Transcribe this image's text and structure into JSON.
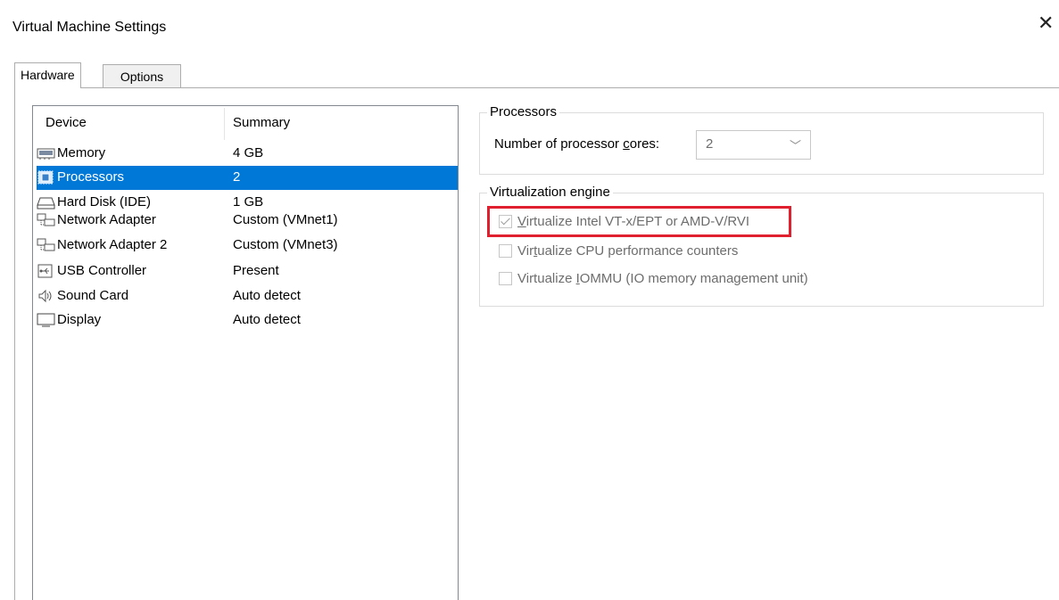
{
  "window": {
    "title": "Virtual Machine Settings",
    "close_icon": "close-icon"
  },
  "tabs": [
    {
      "label": "Hardware",
      "active": true
    },
    {
      "label": "Options",
      "active": false
    }
  ],
  "device_list": {
    "columns": {
      "device": "Device",
      "summary": "Summary"
    },
    "rows": [
      {
        "icon": "memory-icon",
        "device": "Memory",
        "summary": "4 GB",
        "selected": false
      },
      {
        "icon": "processor-icon",
        "device": "Processors",
        "summary": "2",
        "selected": true
      },
      {
        "icon": "hard-disk-icon",
        "device": "Hard Disk (IDE)",
        "summary": "1 GB",
        "selected": false
      },
      {
        "icon": "network-adapter-icon",
        "device": "Network Adapter",
        "summary": "Custom (VMnet1)",
        "selected": false
      },
      {
        "icon": "network-adapter-icon",
        "device": "Network Adapter 2",
        "summary": "Custom (VMnet3)",
        "selected": false
      },
      {
        "icon": "usb-icon",
        "device": "USB Controller",
        "summary": "Present",
        "selected": false
      },
      {
        "icon": "sound-card-icon",
        "device": "Sound Card",
        "summary": "Auto detect",
        "selected": false
      },
      {
        "icon": "display-icon",
        "device": "Display",
        "summary": "Auto detect",
        "selected": false
      }
    ]
  },
  "processors": {
    "group_title": "Processors",
    "cores_label_pre": "Number of processor ",
    "cores_label_ul": "c",
    "cores_label_post": "ores:",
    "cores_value": "2"
  },
  "virtualization": {
    "group_title": "Virtualization engine",
    "options": [
      {
        "pre": "",
        "ul": "V",
        "post": "irtualize Intel VT-x/EPT or AMD-V/RVI",
        "checked": true,
        "disabled": true,
        "highlighted": true
      },
      {
        "pre": "Vir",
        "ul": "t",
        "post": "ualize CPU performance counters",
        "checked": false,
        "disabled": true,
        "highlighted": false
      },
      {
        "pre": "Virtualize ",
        "ul": "I",
        "post": "OMMU (IO memory management unit)",
        "checked": false,
        "disabled": true,
        "highlighted": false
      }
    ]
  },
  "colors": {
    "selection": "#0078d7",
    "highlight_border": "#e0202f",
    "disabled_text": "#6d6d6d"
  }
}
